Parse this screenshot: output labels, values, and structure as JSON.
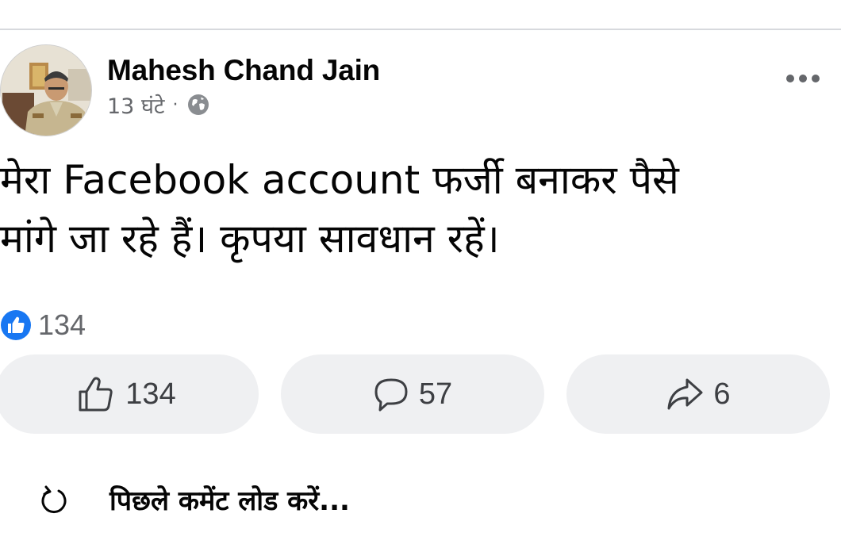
{
  "post": {
    "author": "Mahesh Chand Jain",
    "time": "13 घंटे",
    "separator": "·",
    "privacy_icon": "globe-icon",
    "text": "मेरा Facebook account फर्जी बनाकर पैसे\nमांगे जा रहे हैं। कृपया सावधान रहें।",
    "reactions": {
      "icon": "like-reaction-icon",
      "count": "134"
    },
    "actions": {
      "like_count": "134",
      "comment_count": "57",
      "share_count": "6"
    },
    "load_comments_label": "पिछले कमेंट लोड करें..."
  },
  "colors": {
    "like_blue": "#1877f2",
    "secondary_text": "#65676b",
    "button_bg": "#eff0f2"
  }
}
